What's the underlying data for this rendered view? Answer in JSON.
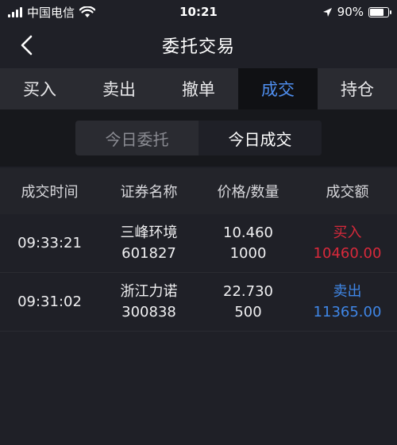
{
  "status_bar": {
    "carrier": "中国电信",
    "time": "10:21",
    "battery": "90%",
    "battery_level": 0.9
  },
  "nav": {
    "title": "委托交易"
  },
  "tabs": [
    {
      "label": "买入",
      "active": false
    },
    {
      "label": "卖出",
      "active": false
    },
    {
      "label": "撤单",
      "active": false
    },
    {
      "label": "成交",
      "active": true
    },
    {
      "label": "持仓",
      "active": false
    }
  ],
  "segments": [
    {
      "label": "今日委托",
      "active": false
    },
    {
      "label": "今日成交",
      "active": true
    }
  ],
  "table": {
    "headers": [
      "成交时间",
      "证券名称",
      "价格/数量",
      "成交额"
    ],
    "rows": [
      {
        "time": "09:33:21",
        "name": "三峰环境",
        "code": "601827",
        "price": "10.460",
        "qty": "1000",
        "side": "买入",
        "amount": "10460.00",
        "type": "buy"
      },
      {
        "time": "09:31:02",
        "name": "浙江力诺",
        "code": "300838",
        "price": "22.730",
        "qty": "500",
        "side": "卖出",
        "amount": "11365.00",
        "type": "sell"
      }
    ]
  },
  "colors": {
    "accent": "#4f8ff0",
    "buy": "#d9293b",
    "sell": "#3f86e6",
    "background": "#1f2027"
  }
}
